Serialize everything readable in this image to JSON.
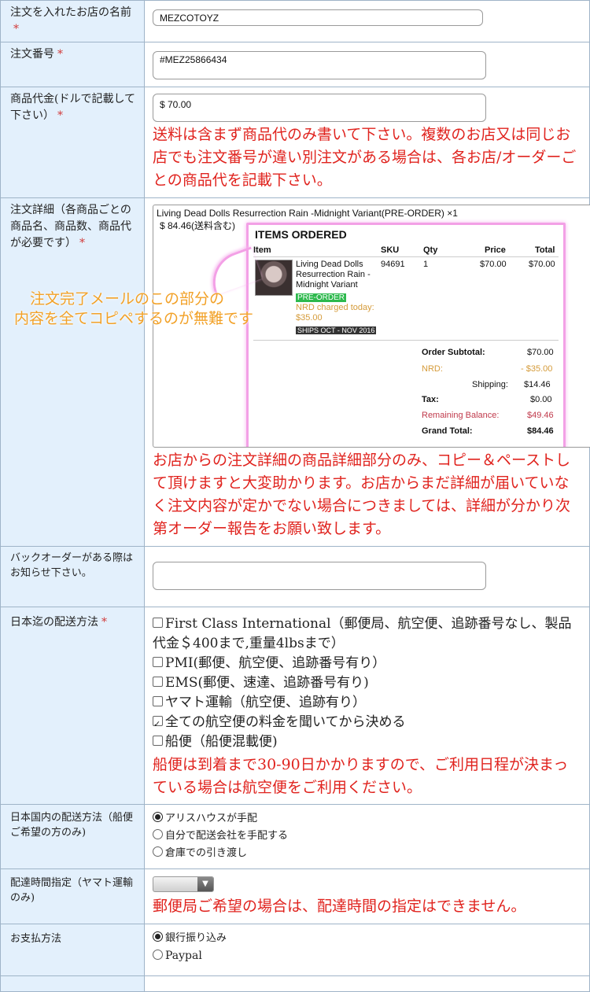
{
  "rows": {
    "shop": {
      "label": "注文を入れたお店の名前",
      "required": "*",
      "value": "MEZCOTOYZ"
    },
    "order_no": {
      "label": "注文番号",
      "required": "*",
      "value": "#MEZ25866434"
    },
    "price": {
      "label": "商品代金(ドルで記載して下さい）",
      "required": "*",
      "value": "$ 70.00",
      "note": "送料は含まず商品代のみ書いて下さい。複数のお店又は同じお店でも注文番号が違い別注文がある場合は、各お店/オーダーごとの商品代を記載下さい。"
    },
    "detail": {
      "label": "注文詳細（各商品ごとの商品名、商品数、商品代が必要です）",
      "required": "*",
      "line1": "Living Dead Dolls Resurrection Rain -Midnight Variant(PRE-ORDER) ×1",
      "line2": "$ 84.46(送料含む)",
      "overlay_line1": "注文完了メールのこの部分の",
      "overlay_line2": "内容を全てコピペするのが無難です",
      "note": "お店からの注文詳細の商品詳細部分のみ、コピー＆ペーストして頂けますと大変助かります。お店からまだ詳細が届いていなく注文内容が定かでない場合につきましては、詳細が分かり次第オーダー報告をお願い致します。",
      "screenshot": {
        "title": "ITEMS ORDERED",
        "headers": {
          "item": "Item",
          "sku": "SKU",
          "qty": "Qty",
          "price": "Price",
          "total": "Total"
        },
        "item_name": "Living Dead Dolls Resurrection Rain - Midnight Variant",
        "tag_preorder": "PRE-ORDER",
        "nrd_charged": "NRD charged today: $35.00",
        "ships": "SHIPS OCT - NOV 2016",
        "sku": "94691",
        "qty": "1",
        "price": "$70.00",
        "total": "$70.00",
        "subtotal_label": "Order Subtotal:",
        "subtotal": "$70.00",
        "nrd_label": "NRD:",
        "nrd": "- $35.00",
        "shipping_label": "Shipping:",
        "shipping": "$14.46",
        "tax_label": "Tax:",
        "tax": "$0.00",
        "remaining_label": "Remaining Balance:",
        "remaining": "$49.46",
        "grand_label": "Grand Total:",
        "grand": "$84.46"
      }
    },
    "backorder": {
      "label": "バックオーダーがある際はお知らせ下さい。",
      "value": ""
    },
    "shipping_intl": {
      "label": "日本迄の配送方法",
      "required": "*",
      "options": [
        {
          "label": "First Class International（郵便局、航空便、追跡番号なし、製品代金＄400まで,重量4lbsまで）",
          "checked": false
        },
        {
          "label": "PMI(郵便、航空便、追跡番号有り）",
          "checked": false
        },
        {
          "label": "EMS(郵便、速達、追跡番号有り)",
          "checked": false
        },
        {
          "label": "ヤマト運輸（航空便、追跡有り）",
          "checked": false
        },
        {
          "label": "全ての航空便の料金を聞いてから決める",
          "checked": true
        },
        {
          "label": "船便（船便混載便)",
          "checked": false
        }
      ],
      "note": "船便は到着まで30-90日かかりますので、ご利用日程が決まっている場合は航空便をご利用ください。"
    },
    "shipping_dom": {
      "label": "日本国内の配送方法（船便ご希望の方のみ)",
      "options": [
        {
          "label": "アリスハウスが手配",
          "checked": true
        },
        {
          "label": "自分で配送会社を手配する",
          "checked": false
        },
        {
          "label": "倉庫での引き渡し",
          "checked": false
        }
      ]
    },
    "delivery_time": {
      "label": "配達時間指定（ヤマト運輸のみ)",
      "select_value": "",
      "note": "郵便局ご希望の場合は、配達時間の指定はできません。"
    },
    "payment": {
      "label": "お支払方法",
      "options": [
        {
          "label": "銀行振り込み",
          "checked": true
        },
        {
          "label": "Paypal",
          "checked": false
        }
      ]
    }
  },
  "colors": {
    "label_bg": "#e3f0fc",
    "border": "#9fb4c8",
    "note_red": "#e0231e",
    "overlay_orange": "#f2a127",
    "highlight_pink": "#f3a0e6"
  }
}
